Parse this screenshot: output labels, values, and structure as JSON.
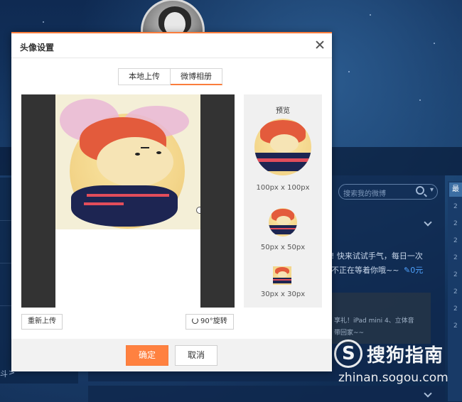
{
  "background": {
    "search_placeholder": "搜索我的微博",
    "feed_line1": "! 快来试试手气，每日一次",
    "feed_line2": "不正在等着你哦~~",
    "feed_price": "0元",
    "card_line1": "享礼！iPad mini 4、立体音",
    "card_line2": "带回家~~",
    "left_label": "斗",
    "watermark_title": "搜狗指南",
    "watermark_url": "zhinan.sogou.com"
  },
  "dialog": {
    "title": "头像设置",
    "tabs": [
      {
        "label": "本地上传",
        "active": false
      },
      {
        "label": "微博相册",
        "active": true
      }
    ],
    "preview": {
      "title": "预览",
      "sizes": [
        "100px x 100px",
        "50px x 50px",
        "30px x 30px"
      ]
    },
    "reupload_label": "重新上传",
    "rotate_label": "90°旋转",
    "confirm_label": "确定",
    "cancel_label": "取消"
  },
  "colors": {
    "accent": "#ff8140",
    "background": "#0d2547"
  }
}
